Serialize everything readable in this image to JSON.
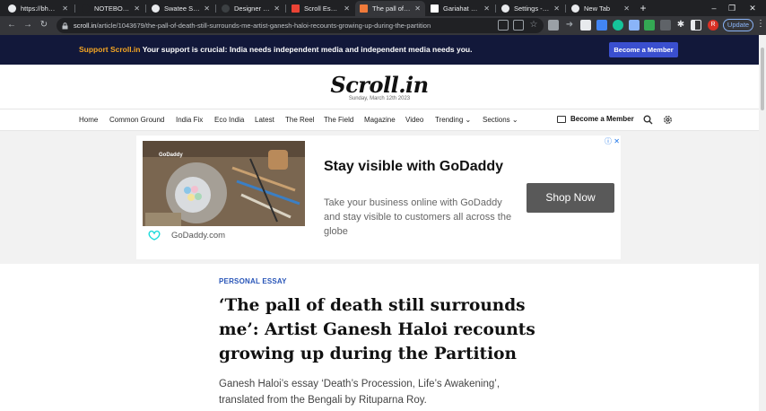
{
  "browser": {
    "tabs": [
      {
        "title": "https://bharat",
        "active": false,
        "favicon_color": "#e8eaed"
      },
      {
        "title": "NOTEBOOK :",
        "active": false,
        "favicon_color": "#202124"
      },
      {
        "title": "Swatee Singh",
        "active": false,
        "favicon_color": "#e8eaed"
      },
      {
        "title": "Designer Wel",
        "active": false,
        "favicon_color": "#3c4043"
      },
      {
        "title": "Scroll Essay -",
        "active": false,
        "favicon_color": "#ea4335"
      },
      {
        "title": "The pall of de",
        "active": true,
        "favicon_color": "#f07a3a"
      },
      {
        "title": "Gariahat Junc",
        "active": false,
        "favicon_color": "#ffffff"
      },
      {
        "title": "Settings - App",
        "active": false,
        "favicon_color": "#e8eaed"
      },
      {
        "title": "New Tab",
        "active": false,
        "favicon_color": "#e8eaed"
      }
    ],
    "new_tab": "+",
    "url_domain": "scroll.in",
    "url_path": "/article/1043679/the-pall-of-death-still-surrounds-me-artist-ganesh-haloi-recounts-growing-up-during-the-partition",
    "avatar_initial": "R",
    "update_label": "Update"
  },
  "support": {
    "brand": "Support Scroll.in",
    "message": " Your support is crucial: India needs independent media and independent media needs you.",
    "button": "Become a Member"
  },
  "masthead": {
    "logo": "Scroll.in",
    "date": "Sunday, March 12th 2023"
  },
  "nav": {
    "items": [
      "Home",
      "Common Ground",
      "India Fix",
      "Eco India",
      "Latest",
      "The Reel",
      "The Field",
      "Magazine",
      "Video",
      "Trending",
      "Sections"
    ],
    "member": "Become a Member"
  },
  "ad": {
    "headline": "Stay visible with GoDaddy",
    "copy": "Take your business online with GoDaddy and stay visible to customers all across the globe",
    "cta": "Shop Now",
    "brand_url": "GoDaddy.com",
    "image_brand": "GoDaddy"
  },
  "article": {
    "kicker": "PERSONAL ESSAY",
    "headline": "‘The pall of death still surrounds me’: Artist Ganesh Haloi recounts growing up during the Partition",
    "dek": "Ganesh Haloi’s essay ‘Death’s Procession, Life’s Awakening’, translated from the Bengali by Rituparna Roy."
  },
  "colors": {
    "support_bar": "#12183a",
    "support_brand": "#f5a623",
    "member_button": "#3a4fcf",
    "kicker": "#2855b8"
  }
}
